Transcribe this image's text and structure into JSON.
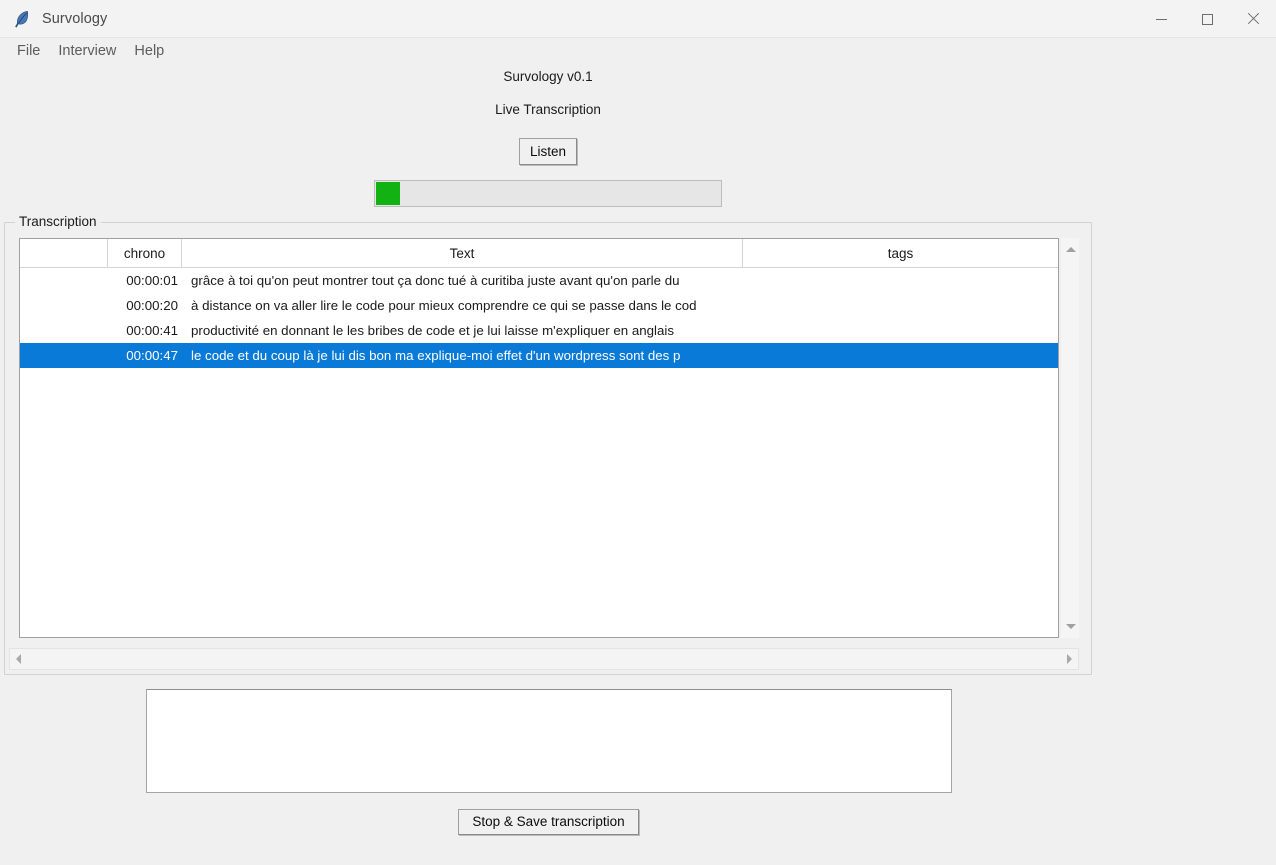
{
  "window": {
    "title": "Survology",
    "icon": "feather-icon",
    "controls": {
      "minimize": "minimize-icon",
      "maximize": "maximize-icon",
      "close": "close-icon"
    }
  },
  "menubar": {
    "items": [
      {
        "label": "File"
      },
      {
        "label": "Interview"
      },
      {
        "label": "Help"
      }
    ]
  },
  "header": {
    "app_version": "Survology v0.1",
    "mode_title": "Live Transcription",
    "listen_label": "Listen"
  },
  "level_meter": {
    "fill_color": "#12b212",
    "track_color": "#e6e6e6",
    "fill_percent": 7
  },
  "transcription": {
    "group_label": "Transcription",
    "columns": [
      "",
      "chrono",
      "Text",
      "tags"
    ],
    "selection_color": "#0a7ad8",
    "rows": [
      {
        "tree": "",
        "chrono": "00:00:01",
        "text": "grâce à toi qu'on peut montrer tout ça donc tué à curitiba juste avant qu'on parle du",
        "tags": "",
        "selected": false
      },
      {
        "tree": "",
        "chrono": "00:00:20",
        "text": "à distance on va aller lire le code pour mieux comprendre ce qui se passe dans le cod",
        "tags": "",
        "selected": false
      },
      {
        "tree": "",
        "chrono": "00:00:41",
        "text": "productivité en donnant le les bribes de code et je lui laisse m'expliquer en anglais",
        "tags": "",
        "selected": false
      },
      {
        "tree": "",
        "chrono": "00:00:47",
        "text": "le code et du coup là je lui dis bon ma explique-moi effet d'un wordpress sont des p",
        "tags": "",
        "selected": true
      }
    ],
    "vscroll": {
      "up_icon": "scroll-up-arrow-icon",
      "down_icon": "scroll-down-arrow-icon"
    },
    "hscroll": {
      "left_icon": "scroll-left-arrow-icon",
      "right_icon": "scroll-right-arrow-icon"
    }
  },
  "notes": {
    "value": "",
    "placeholder": ""
  },
  "footer": {
    "stop_save_label": "Stop & Save transcription"
  }
}
